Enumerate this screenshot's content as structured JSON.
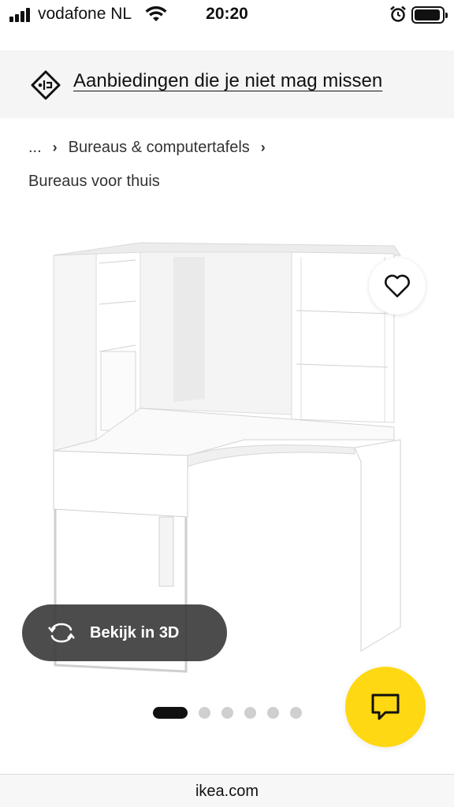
{
  "status_bar": {
    "carrier": "vodafone NL",
    "time": "20:20",
    "icons": [
      "signal-icon",
      "wifi-icon",
      "alarm-icon",
      "battery-icon"
    ]
  },
  "promo": {
    "icon": "offer-tag-icon",
    "link_text": "Aanbiedingen die je niet mag missen"
  },
  "breadcrumb": {
    "ellipsis": "...",
    "items": [
      "Bureaus & computertafels",
      "Bureaus voor thuis"
    ]
  },
  "product": {
    "image_icon": "corner-desk-image",
    "wishlist_icon": "heart-icon"
  },
  "view3d": {
    "icon": "rotate-3d-icon",
    "label": "Bekijk in 3D"
  },
  "carousel": {
    "total": 6,
    "active_index": 0
  },
  "chat": {
    "icon": "chat-icon"
  },
  "browser": {
    "url": "ikea.com"
  },
  "colors": {
    "promo_bg": "#f5f5f5",
    "chat_fab": "#fed812",
    "view3d_bg": "#383838"
  }
}
